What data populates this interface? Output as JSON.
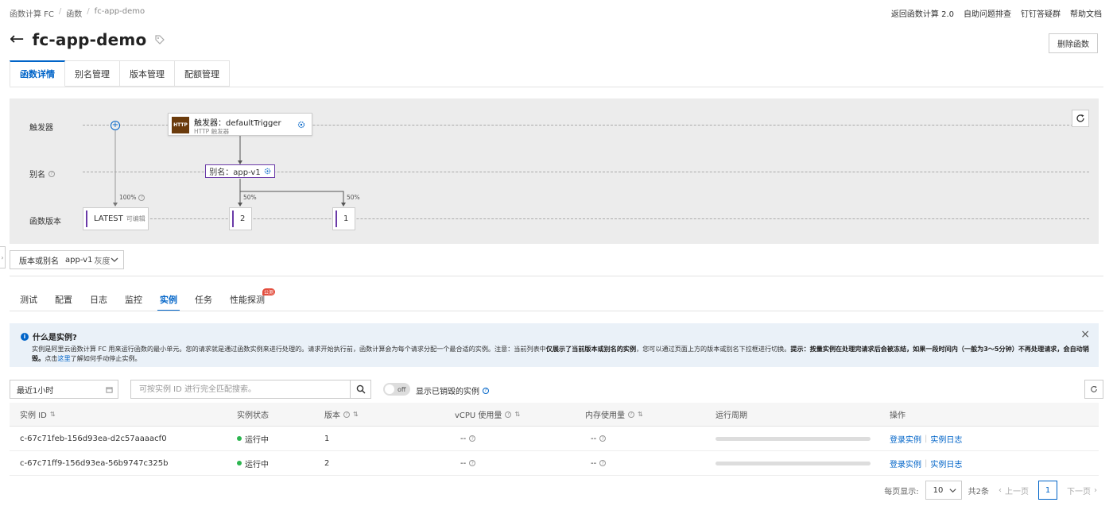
{
  "breadcrumb": [
    "函数计算 FC",
    "函数",
    "fc-app-demo"
  ],
  "top_links": [
    "返回函数计算 2.0",
    "自助问题排查",
    "钉钉答疑群",
    "帮助文档"
  ],
  "title": "fc-app-demo",
  "delete_label": "删除函数",
  "main_tabs": [
    "函数详情",
    "别名管理",
    "版本管理",
    "配额管理"
  ],
  "diagram": {
    "rows": {
      "trigger": "触发器",
      "alias": "别名",
      "version": "函数版本"
    },
    "trigger_name": "触发器：defaultTrigger",
    "trigger_type": "HTTP 触发器",
    "trigger_badge": "HTTP",
    "alias": "别名：app-v1",
    "pct_latest": "100%",
    "pct_2": "50%",
    "pct_1": "50%",
    "versions": [
      {
        "label": "LATEST",
        "sub": "可编辑"
      },
      {
        "label": "2",
        "sub": ""
      },
      {
        "label": "1",
        "sub": ""
      }
    ]
  },
  "version_select": {
    "label": "版本或别名",
    "value": "app-v1",
    "gray": "灰度"
  },
  "sub_tabs": [
    "测试",
    "配置",
    "日志",
    "监控",
    "实例",
    "任务",
    "性能探测"
  ],
  "sub_tab_badge": "公测",
  "notice": {
    "title": "什么是实例?",
    "p1": "实例是阿里云函数计算 FC 用来运行函数的最小单元。您的请求就是通过函数实例来进行处理的。请求开始执行前，函数计算会为每个请求分配一个最合适的实例。注意：当前列表中",
    "b1": "仅展示了当前版本或别名的实例",
    "p2": "，您可以通过页面上方的版本或别名下拉框进行切换。",
    "b2": "提示：按量实例在处理完请求后会被冻结，如果一段时间内（一般为3～5分钟）不再处理请求，会自动销毁。",
    "p3": "点击",
    "link": "这里",
    "p4": "了解如何手动停止实例。"
  },
  "filters": {
    "time": "最近1小时",
    "search_placeholder": "可按实例 ID 进行完全匹配搜索。",
    "toggle": "off",
    "toggle_label": "显示已销毁的实例"
  },
  "table": {
    "headers": [
      "实例 ID",
      "实例状态",
      "版本",
      "vCPU 使用量",
      "内存使用量",
      "运行周期",
      "操作"
    ],
    "rows": [
      {
        "id": "c-67c71feb-156d93ea-d2c57aaaacf0",
        "status": "运行中",
        "version": "1",
        "vcpu": "--",
        "mem": "--",
        "login": "登录实例",
        "log": "实例日志"
      },
      {
        "id": "c-67c71ff9-156d93ea-56b9747c325b",
        "status": "运行中",
        "version": "2",
        "vcpu": "--",
        "mem": "--",
        "login": "登录实例",
        "log": "实例日志"
      }
    ]
  },
  "pager": {
    "per_page_label": "每页显示:",
    "per_page": "10",
    "total": "共2条",
    "prev": "上一页",
    "page": "1",
    "next": "下一页"
  }
}
